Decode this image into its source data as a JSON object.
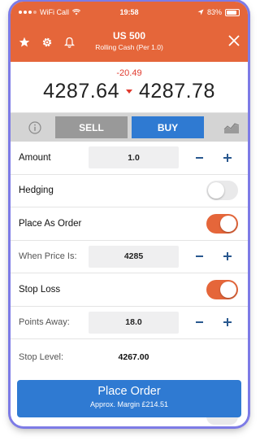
{
  "status": {
    "carrier": "WiFi Call",
    "time": "19:58",
    "battery": "83%"
  },
  "header": {
    "title": "US 500",
    "subtitle": "Rolling Cash (Per 1.0)"
  },
  "price": {
    "change": "-20.49",
    "sell": "4287.64",
    "buy": "4287.78"
  },
  "trade": {
    "sell_label": "SELL",
    "buy_label": "BUY"
  },
  "rows": {
    "amount": {
      "label": "Amount",
      "value": "1.0"
    },
    "hedging": {
      "label": "Hedging",
      "on": false
    },
    "place_as_order": {
      "label": "Place As Order",
      "on": true
    },
    "when_price": {
      "label": "When Price Is:",
      "value": "4285"
    },
    "stop_loss": {
      "label": "Stop Loss",
      "on": true
    },
    "points_away": {
      "label": "Points Away:",
      "value": "18.0"
    },
    "stop_level": {
      "label": "Stop Level:",
      "value": "4267.00"
    }
  },
  "order": {
    "label": "Place Order",
    "margin": "Approx. Margin £214.51"
  },
  "colors": {
    "brand": "#e5663a",
    "buy": "#2f7ad2",
    "sell": "#999999",
    "negative": "#e03a2e"
  }
}
